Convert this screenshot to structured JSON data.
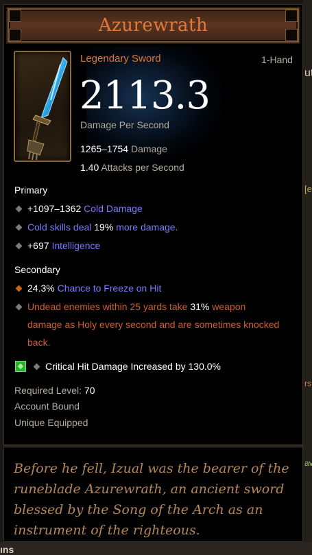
{
  "item": {
    "name": "Azurewrath",
    "type": "Legendary Sword",
    "slot": "1-Hand",
    "dps": "2113.3",
    "dps_label": "Damage Per Second",
    "damage_range": "1265–1754",
    "damage_label": "Damage",
    "aps": "1.40",
    "aps_label": "Attacks per Second",
    "icon": "sword-icon",
    "accent_color": "#e0753a"
  },
  "primary": {
    "heading": "Primary",
    "stats": [
      {
        "value": "+1097–1362",
        "text": "Cold Damage"
      },
      {
        "pre": "Cold skills deal",
        "value": "19%",
        "text": "more damage."
      },
      {
        "value": "+697",
        "text": "Intelligence"
      }
    ]
  },
  "secondary": {
    "heading": "Secondary",
    "stats": [
      {
        "value": "24.3%",
        "text": "Chance to Freeze on Hit"
      },
      {
        "line1_pre": "Undead enemies within 25 yards take",
        "line1_value": "31%",
        "line1_post": "weapon",
        "line2": "damage as Holy every second and are sometimes knocked",
        "line3": "back."
      }
    ]
  },
  "socket": {
    "icon": "emerald-gem-icon",
    "text": "Critical Hit Damage Increased by 130.0%"
  },
  "requirements": {
    "level_label": "Required Level:",
    "level_value": "70",
    "bound": "Account Bound",
    "unique": "Unique Equipped"
  },
  "flavor": [
    "Before he fell, Izual was the bearer of the",
    "runeblade Azurewrath, an ancient sword",
    "blessed by the Song of the Arch as an",
    "instrument of the righteous."
  ],
  "background": {
    "right_fragments": [
      "ut",
      "[e",
      "rs",
      "av"
    ],
    "bottom_fragment": "ıns"
  }
}
